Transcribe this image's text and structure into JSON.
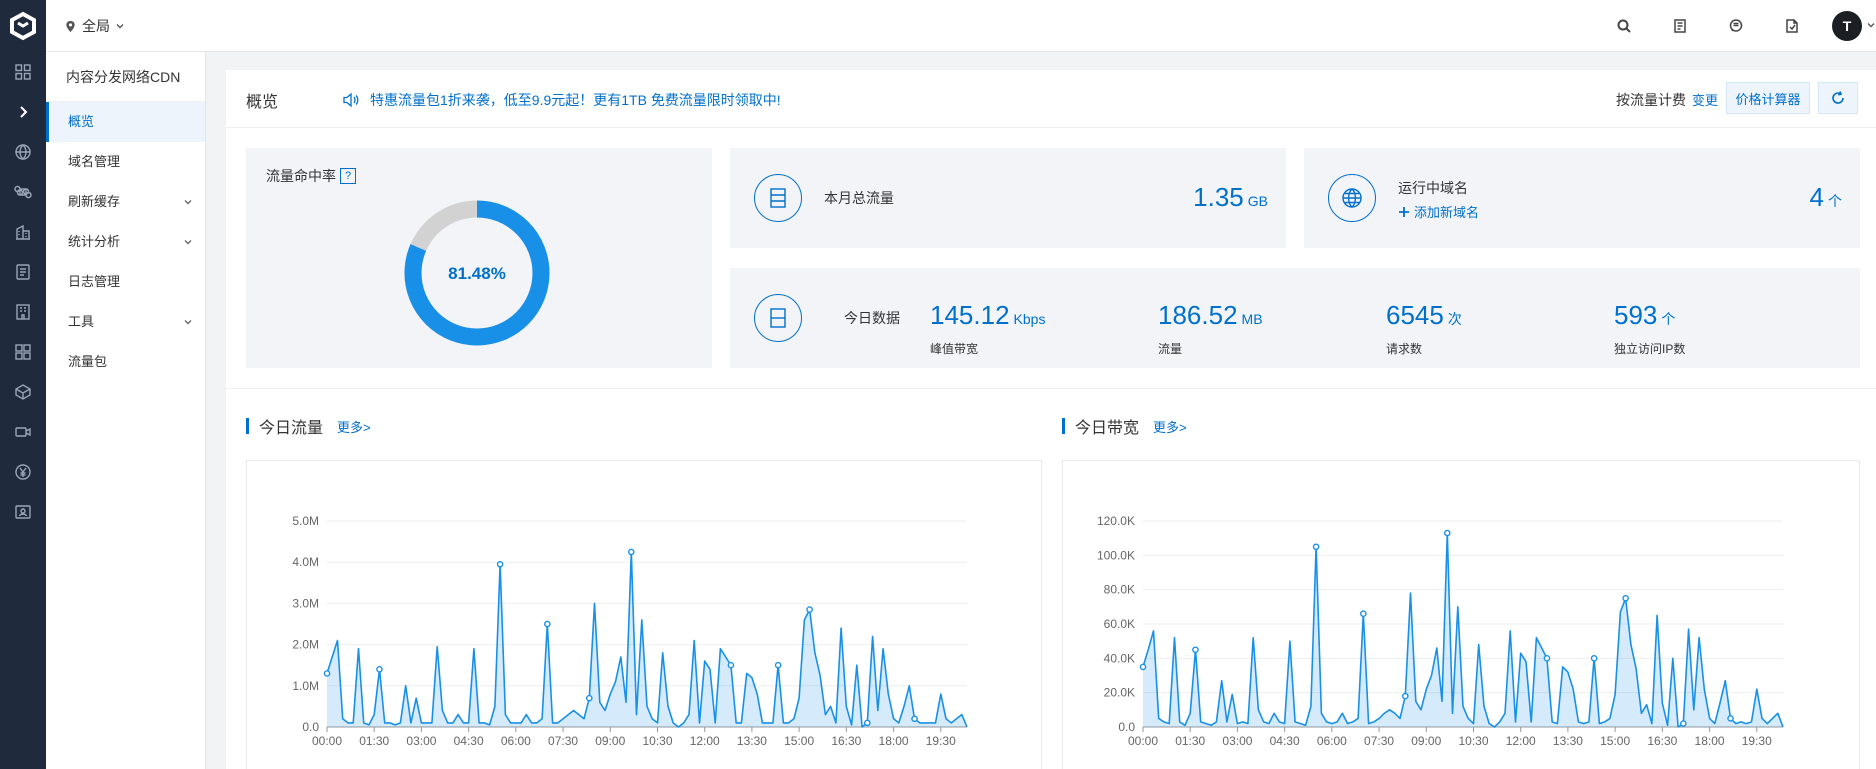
{
  "rail": {
    "icons": [
      "dashboard-grid-icon",
      "expand-arrow-icon",
      "globe-icon",
      "command-icon",
      "building-icon",
      "document-icon",
      "building-alt-icon",
      "apps-grid-icon",
      "box-icon",
      "video-icon",
      "yen-icon",
      "id-card-icon"
    ]
  },
  "topbar": {
    "scope": "全局",
    "avatar": "T"
  },
  "sidenav": {
    "title": "内容分发网络CDN",
    "items": [
      {
        "label": "概览",
        "active": true,
        "expandable": false
      },
      {
        "label": "域名管理",
        "active": false,
        "expandable": false
      },
      {
        "label": "刷新缓存",
        "active": false,
        "expandable": true
      },
      {
        "label": "统计分析",
        "active": false,
        "expandable": true
      },
      {
        "label": "日志管理",
        "active": false,
        "expandable": false
      },
      {
        "label": "工具",
        "active": false,
        "expandable": true
      },
      {
        "label": "流量包",
        "active": false,
        "expandable": false
      }
    ]
  },
  "header": {
    "title": "概览",
    "notice": "特惠流量包1折来袭，低至9.9元起！更有1TB 免费流量限时领取中!",
    "billing": "按流量计费",
    "change": "变更",
    "calculator": "价格计算器"
  },
  "hit_rate": {
    "title": "流量命中率",
    "help": "?",
    "value": "81.48%",
    "fraction": 0.8148
  },
  "monthly": {
    "label": "本月总流量",
    "value": "1.35",
    "unit": "GB"
  },
  "domains": {
    "label": "运行中域名",
    "add": "添加新域名",
    "value": "4",
    "unit": "个"
  },
  "today": {
    "label": "今日数据",
    "stats": [
      {
        "value": "145.12",
        "unit": "Kbps",
        "label": "峰值带宽"
      },
      {
        "value": "186.52",
        "unit": "MB",
        "label": "流量"
      },
      {
        "value": "6545",
        "unit": "次",
        "label": "请求数"
      },
      {
        "value": "593",
        "unit": "个",
        "label": "独立访问IP数"
      }
    ]
  },
  "sections": {
    "traffic": {
      "title": "今日流量",
      "more": "更多>"
    },
    "bandwidth": {
      "title": "今日带宽",
      "more": "更多>"
    }
  },
  "chart_data": [
    {
      "type": "area",
      "title": "今日流量",
      "x_tick_labels": [
        "00:00",
        "01:30",
        "03:00",
        "04:30",
        "06:00",
        "07:30",
        "09:00",
        "10:30",
        "12:00",
        "13:30",
        "15:00",
        "16:30",
        "18:00",
        "19:30"
      ],
      "y_tick_labels": [
        "0.0",
        "1.0M",
        "2.0M",
        "3.0M",
        "4.0M",
        "5.0M"
      ],
      "ylim": [
        0,
        5.0
      ],
      "y_unit": "M",
      "interval_minutes": 10,
      "values": [
        1.3,
        1.7,
        2.1,
        0.2,
        0.1,
        0.1,
        1.9,
        0.1,
        0.05,
        0.3,
        1.4,
        0.1,
        0.1,
        0.05,
        0.1,
        1.0,
        0.1,
        0.7,
        0.1,
        0.1,
        0.1,
        1.95,
        0.4,
        0.1,
        0.1,
        0.3,
        0.1,
        0.1,
        1.9,
        0.1,
        0.1,
        0.05,
        0.5,
        3.95,
        0.3,
        0.1,
        0.1,
        0.1,
        0.3,
        0.1,
        0.1,
        0.2,
        2.5,
        0.1,
        0.1,
        0.2,
        0.3,
        0.4,
        0.3,
        0.2,
        0.7,
        3.0,
        0.6,
        0.4,
        0.8,
        1.1,
        1.7,
        0.6,
        4.25,
        0.3,
        2.6,
        0.5,
        0.2,
        0.1,
        1.8,
        0.5,
        0.1,
        0.0,
        0.1,
        0.3,
        2.1,
        0.1,
        1.6,
        1.4,
        0.1,
        1.9,
        1.7,
        1.5,
        0.1,
        0.1,
        1.3,
        1.2,
        0.8,
        0.1,
        0.1,
        0.1,
        1.5,
        0.1,
        0.1,
        0.2,
        0.7,
        2.6,
        2.85,
        1.8,
        1.25,
        0.3,
        0.5,
        0.1,
        2.4,
        0.5,
        0.05,
        1.5,
        0.0,
        0.1,
        2.2,
        0.4,
        1.9,
        0.8,
        0.2,
        0.1,
        0.5,
        1.0,
        0.2,
        0.1,
        0.1,
        0.1,
        0.1,
        0.8,
        0.2,
        0.1,
        0.2,
        0.3,
        0.0
      ],
      "markers": [
        0,
        10,
        33,
        42,
        50,
        58,
        77,
        86,
        92,
        103,
        112
      ]
    },
    {
      "type": "area",
      "title": "今日带宽",
      "x_tick_labels": [
        "00:00",
        "01:30",
        "03:00",
        "04:30",
        "06:00",
        "07:30",
        "09:00",
        "10:30",
        "12:00",
        "13:30",
        "15:00",
        "16:30",
        "18:00",
        "19:30"
      ],
      "y_tick_labels": [
        "0.0",
        "20.0K",
        "40.0K",
        "60.0K",
        "80.0K",
        "100.0K",
        "120.0K"
      ],
      "ylim": [
        0,
        120
      ],
      "y_unit": "K",
      "interval_minutes": 10,
      "values": [
        35,
        45,
        56,
        5,
        3,
        2,
        52,
        3,
        1,
        8,
        45,
        3,
        2,
        1,
        3,
        27,
        3,
        19,
        2,
        3,
        2,
        52,
        10,
        3,
        2,
        8,
        3,
        2,
        50,
        3,
        2,
        1,
        12,
        105,
        8,
        3,
        2,
        3,
        8,
        2,
        3,
        5,
        66,
        2,
        3,
        5,
        8,
        10,
        8,
        5,
        18,
        78,
        15,
        10,
        22,
        30,
        46,
        15,
        113,
        8,
        70,
        12,
        5,
        2,
        48,
        12,
        2,
        0,
        3,
        8,
        56,
        3,
        43,
        38,
        3,
        52,
        46,
        40,
        3,
        2,
        35,
        32,
        22,
        3,
        2,
        3,
        40,
        2,
        3,
        5,
        19,
        67,
        75,
        48,
        34,
        8,
        13,
        2,
        65,
        14,
        1,
        40,
        0,
        2,
        57,
        10,
        52,
        22,
        5,
        2,
        14,
        27,
        5,
        2,
        3,
        2,
        3,
        22,
        5,
        2,
        5,
        8,
        0
      ],
      "markers": [
        0,
        10,
        33,
        42,
        50,
        58,
        77,
        86,
        92,
        103,
        112
      ]
    }
  ]
}
